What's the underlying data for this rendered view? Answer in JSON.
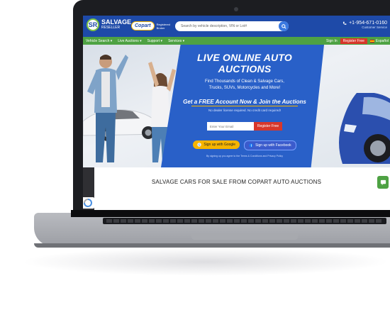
{
  "header": {
    "logo_mark": "SR",
    "logo_name": "SALVAGE",
    "logo_sub": "RESELLER",
    "copart_badge": "Copart",
    "copart_sub": "Registered Broker",
    "search_placeholder": "Search by vehicle description, VIN or Lot#",
    "phone": "+1-954-671-0160",
    "hours": "Customer Service"
  },
  "nav": {
    "items": [
      "Vehicle Search ▾",
      "Live Auctions ▾",
      "Support ▾",
      "Services ▾"
    ],
    "signin": "Sign In",
    "register": "Register Free",
    "language": "Español"
  },
  "hero": {
    "title": "LIVE ONLINE AUTO AUCTIONS",
    "subtitle_line1": "Find Thousands of Clean & Salvage Cars,",
    "subtitle_line2": "Trucks, SUVs, Motorcycles and More!",
    "cta": "Get a FREE Account Now & Join the Auctions",
    "cta_note": "No dealer license required. No credit card required!",
    "email_placeholder": "Enter Your Email",
    "register_button": "Register Free",
    "google_button": "Sign up with Google",
    "facebook_button": "Sign up with Facebook",
    "terms": "By signing up you agree to the Terms & Conditions and Privacy Policy"
  },
  "section": {
    "title": "SALVAGE CARS FOR SALE FROM COPART AUTO AUCTIONS"
  },
  "colors": {
    "header_blue": "#1e4aa8",
    "nav_green": "#4ea243",
    "banner_blue": "#2960c8",
    "accent_red": "#d8372b",
    "accent_yellow": "#f5b400"
  }
}
